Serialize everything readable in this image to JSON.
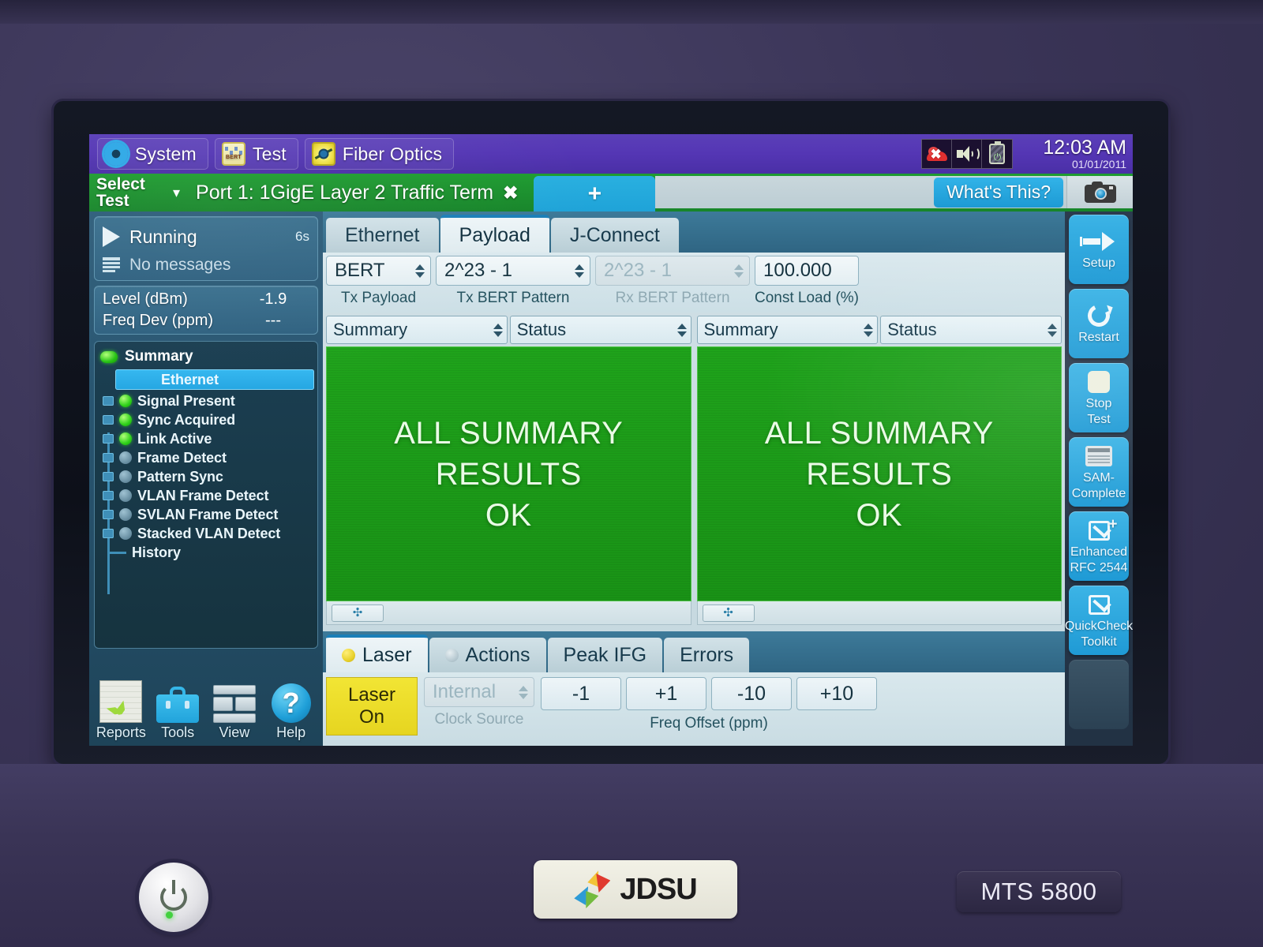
{
  "device": {
    "brand": "JDSU",
    "model": "MTS 5800",
    "power_button_icon": "power-icon"
  },
  "topbar": {
    "menus": [
      {
        "label": "System",
        "icon": "gear-icon"
      },
      {
        "label": "Test",
        "icon": "bert-icon"
      },
      {
        "label": "Fiber Optics",
        "icon": "fiber-optics-icon"
      }
    ],
    "tray": [
      {
        "icon": "no-network-icon"
      },
      {
        "icon": "speaker-icon"
      },
      {
        "icon": "battery-charging-icon"
      }
    ],
    "clock": {
      "time": "12:03 AM",
      "date": "01/01/2011"
    }
  },
  "tabbar": {
    "select_test_line1": "Select",
    "select_test_line2": "Test",
    "caret": "▾",
    "port_tab": {
      "label": "Port 1: 1GigE Layer 2 Traffic Term",
      "close": "✖"
    },
    "add_tab": "+",
    "whats_this": "What's This?",
    "camera_icon": "camera-icon"
  },
  "left_panel": {
    "run_state": "Running",
    "run_time": "6s",
    "messages": "No messages",
    "metrics": [
      {
        "key": "Level (dBm)",
        "value": "-1.9"
      },
      {
        "key": "Freq Dev (ppm)",
        "value": "---"
      }
    ],
    "tree": {
      "root": "Summary",
      "group": "Ethernet",
      "items": [
        {
          "label": "Signal Present",
          "state": "on"
        },
        {
          "label": "Sync Acquired",
          "state": "on"
        },
        {
          "label": "Link Active",
          "state": "on"
        },
        {
          "label": "Frame Detect",
          "state": "off"
        },
        {
          "label": "Pattern Sync",
          "state": "off"
        },
        {
          "label": "VLAN Frame Detect",
          "state": "off"
        },
        {
          "label": "SVLAN Frame Detect",
          "state": "off"
        },
        {
          "label": "Stacked VLAN Detect",
          "state": "off"
        }
      ],
      "history": "History"
    },
    "tools": [
      {
        "label": "Reports",
        "icon": "reports-icon"
      },
      {
        "label": "Tools",
        "icon": "toolbox-icon"
      },
      {
        "label": "View",
        "icon": "view-layout-icon"
      },
      {
        "label": "Help",
        "icon": "help-question-icon"
      }
    ]
  },
  "center": {
    "payload_tabs": [
      {
        "label": "Ethernet",
        "active": false
      },
      {
        "label": "Payload",
        "active": true
      },
      {
        "label": "J-Connect",
        "active": false
      }
    ],
    "params": [
      {
        "value": "BERT",
        "label": "Tx Payload",
        "disabled": false
      },
      {
        "value": "2^23 - 1",
        "label": "Tx BERT Pattern",
        "disabled": false
      },
      {
        "value": "2^23 - 1",
        "label": "Rx BERT Pattern",
        "disabled": true
      },
      {
        "value": "100.000",
        "label": "Const Load (%)",
        "disabled": false,
        "nospin": true
      }
    ],
    "results": [
      {
        "select_left": "Summary",
        "select_right": "Status",
        "lines": [
          "ALL SUMMARY",
          "RESULTS",
          "OK"
        ],
        "color": "#1fa31b",
        "move_icon": "move-handle-icon"
      },
      {
        "select_left": "Summary",
        "select_right": "Status",
        "lines": [
          "ALL SUMMARY",
          "RESULTS",
          "OK"
        ],
        "color": "#1fa31b",
        "move_icon": "move-handle-icon"
      }
    ],
    "bottom_tabs": [
      {
        "label": "Laser",
        "dot": "yellow",
        "active": true
      },
      {
        "label": "Actions",
        "dot": "grey",
        "active": false
      },
      {
        "label": "Peak IFG",
        "dot": "none",
        "active": false
      },
      {
        "label": "Errors",
        "dot": "none",
        "active": false
      }
    ],
    "laser_button": {
      "line1": "Laser",
      "line2": "On"
    },
    "clock_source": {
      "value": "Internal",
      "label": "Clock Source",
      "disabled": true
    },
    "freq_offset": {
      "buttons": [
        "-1",
        "+1",
        "-10",
        "+10"
      ],
      "label": "Freq Offset (ppm)"
    }
  },
  "right_bar": {
    "buttons": [
      {
        "line1": "Setup",
        "line2": "",
        "icon": "arrow-right-icon",
        "blank": false
      },
      {
        "line1": "Restart",
        "line2": "",
        "icon": "restart-icon",
        "blank": false
      },
      {
        "line1": "Stop",
        "line2": "Test",
        "icon": "stop-square-icon",
        "blank": false
      },
      {
        "line1": "SAM-",
        "line2": "Complete",
        "icon": "sam-window-icon",
        "blank": false
      },
      {
        "line1": "Enhanced",
        "line2": "RFC 2544",
        "icon": "checkbox-plus-icon",
        "blank": false
      },
      {
        "line1": "QuickCheck",
        "line2": "Toolkit",
        "icon": "checkbox-icon",
        "blank": false
      },
      {
        "line1": "",
        "line2": "",
        "icon": "none",
        "blank": true
      }
    ]
  }
}
